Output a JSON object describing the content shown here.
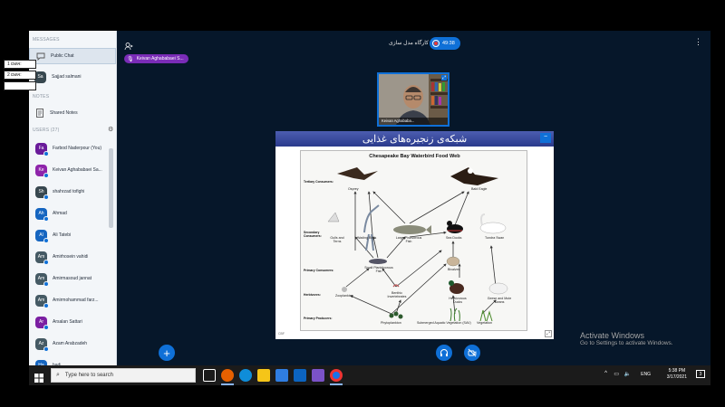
{
  "sidebar": {
    "messages_header": "MESSAGES",
    "public_chat": "Public Chat",
    "private_chat": "Sajjad salmani",
    "private_chat_initials": "Sa",
    "notes_header": "NOTES",
    "shared_notes": "Shared Notes",
    "users_header": "USERS (27)",
    "users": [
      {
        "initials": "Fa",
        "name": "Farbod Naderpour (You)",
        "color": "#6a1b9a"
      },
      {
        "initials": "Ke",
        "name": "Keivan Aghababaei Sa...",
        "color": "#8e24aa"
      },
      {
        "initials": "Sh",
        "name": "shahrzad tofighi",
        "color": "#37474f"
      },
      {
        "initials": "Ah",
        "name": "Ahmad",
        "color": "#1565c0"
      },
      {
        "initials": "Al",
        "name": "Ali Tatebi",
        "color": "#1565c0"
      },
      {
        "initials": "Am",
        "name": "Amirhosein vahidi",
        "color": "#455a64"
      },
      {
        "initials": "Am",
        "name": "Amirmasoud jannat",
        "color": "#455a64"
      },
      {
        "initials": "Am",
        "name": "Amirmohammad farz...",
        "color": "#455a64"
      },
      {
        "initials": "Ar",
        "name": "Arsalan Sattari",
        "color": "#7b1fa2"
      },
      {
        "initials": "Az",
        "name": "Azam Arabzadeh",
        "color": "#455a64"
      },
      {
        "initials": "Ha",
        "name": "hadi",
        "color": "#1565c0"
      }
    ]
  },
  "sticky": {
    "n1": "אשם 1:",
    "n2": "אשם 2:"
  },
  "header": {
    "session_title": "کارگاه مدل سازی",
    "timer": "49:38"
  },
  "presenter_chip": "Keivan Aghababaei S...",
  "webcam": {
    "name": "Keivan Aghababa..."
  },
  "presentation": {
    "title": "شبکه‌ی زنجیره‌های غذایی",
    "figure_title": "Chesapeake Bay Waterbird Food Web",
    "levels": [
      "Tertiary Consumers:",
      "Secondary Consumers:",
      "Primary Consumers:",
      "Herbivores:",
      "Primary Producers:"
    ],
    "organisms": [
      "Osprey",
      "Bald Eagle",
      "Gulls and Terns",
      "Wading Birds",
      "Large Piscivorous Fish",
      "Sea Ducks",
      "Tundra Swan",
      "Small Planktivorous Fish",
      "Bivalves",
      "Zooplankton",
      "Benthic Invertebrates",
      "Herbivorous Ducks",
      "Geese and Mute Swans",
      "Phytoplankton",
      "Submerged Aquatic Vegetation (SAV)",
      "Vegetation"
    ],
    "credit": "CBF"
  },
  "activate": {
    "title": "Activate Windows",
    "sub": "Go to Settings to activate Windows."
  },
  "taskbar": {
    "search_placeholder": "Type here to search",
    "lang": "ENG",
    "time": "5:38 PM",
    "date": "3/17/2021"
  },
  "colors": {
    "accent": "#0f70d7",
    "bg": "#06172a",
    "chip": "#7a2cb7"
  }
}
